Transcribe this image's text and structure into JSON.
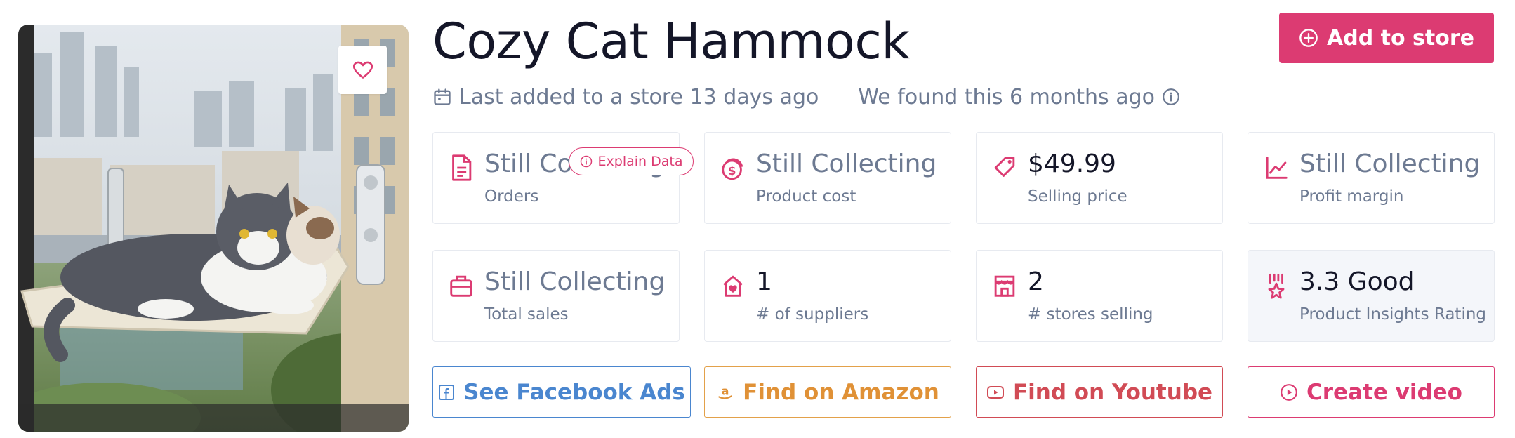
{
  "product": {
    "title": "Cozy Cat Hammock",
    "image_alt": "Two cats lying on a window-mounted cat hammock"
  },
  "header": {
    "add_to_store_label": "Add to store",
    "last_added": "Last added to a store 13 days ago",
    "found": "We found this 6 months ago"
  },
  "explain_chip": {
    "label": "Explain Data"
  },
  "stats": [
    {
      "value": "Still Collecting",
      "label": "Orders",
      "icon": "document-icon"
    },
    {
      "value": "Still Collecting",
      "label": "Product cost",
      "icon": "coins-icon"
    },
    {
      "value": "$49.99",
      "label": "Selling price",
      "icon": "price-tag-icon"
    },
    {
      "value": "Still Collecting",
      "label": "Profit margin",
      "icon": "trend-chart-icon"
    },
    {
      "value": "Still Collecting",
      "label": "Total sales",
      "icon": "briefcase-icon"
    },
    {
      "value": "1",
      "label": "# of suppliers",
      "icon": "house-heart-icon"
    },
    {
      "value": "2",
      "label": "# stores selling",
      "icon": "storefront-icon"
    },
    {
      "value": "3.3 Good",
      "label": "Product Insights Rating",
      "icon": "award-icon"
    }
  ],
  "actions": {
    "facebook_label": "See Facebook Ads",
    "amazon_label": "Find on Amazon",
    "youtube_label": "Find on Youtube",
    "video_label": "Create video"
  },
  "colors": {
    "accent": "#dc3b72",
    "muted_text": "#6d7a92",
    "facebook": "#4a86cf",
    "amazon": "#e09136",
    "youtube": "#d14b55"
  }
}
